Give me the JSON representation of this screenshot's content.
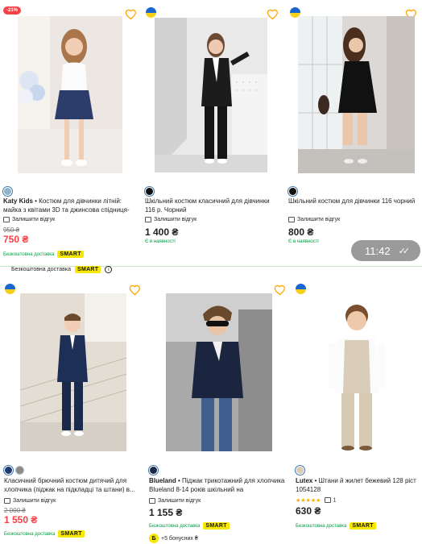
{
  "products_top": [
    {
      "discount": "-21%",
      "colors": [
        "#8fb2cc"
      ],
      "brand": "Katy Kids",
      "title": " • Костюм для дівчинки літній: майка з квітами 3D та джинсова спідниця-шорти з...",
      "review_label": "Залишити відгук",
      "old_price": "950 ₴",
      "price": "750 ₴",
      "shipping": "Безкоштовна доставка",
      "smart": "SMART"
    },
    {
      "colors": [
        "#111111"
      ],
      "brand": "",
      "title": "Шкільний костюм класичний для дівчинки 116 р. Чорний",
      "review_label": "Залишити відгук",
      "price": "1 400 ₴",
      "availability": "Є в наявності"
    },
    {
      "colors": [
        "#111111"
      ],
      "brand": "",
      "title": "Шкільний костюм для дівчинки 116 чорний",
      "review_label": "Залишити відгук",
      "price": "800 ₴",
      "availability": "Є в наявності"
    }
  ],
  "strip": {
    "shipping": "Безкоштовна доставка",
    "smart": "SMART",
    "info": "i",
    "time": "11:42",
    "ticks": "✓✓"
  },
  "products_bottom": [
    {
      "colors": [
        "#1e3a6e",
        "#8a8a8a"
      ],
      "brand": "",
      "title": "Класичний брючний костюм дитячий для хлопчика (піджак на підкладці та штани) в...",
      "review_label": "Залишити відгук",
      "old_price": "2 000 ₴",
      "price": "1 550 ₴",
      "shipping": "Безкоштовна доставка",
      "smart": "SMART"
    },
    {
      "colors": [
        "#1e2a44"
      ],
      "brand": "Blueland",
      "title": " • Піджак трикотажний для хлопчика Blueland 8-14 років шкільний на демісезонни...",
      "review_label": "Залишити відгук",
      "price": "1 155 ₴",
      "shipping": "Безкоштовна доставка",
      "smart": "SMART",
      "bonus_badge": "Б",
      "bonus": "+5 бонусних ₴"
    },
    {
      "colors": [
        "#d8cbb8"
      ],
      "brand": "Lutex",
      "title": " • Штани й жилет бежевий 128 ріст 1054128",
      "rating_stars": 5,
      "stars": "★★★★★",
      "review_count": "1",
      "price": "630 ₴",
      "shipping": "Безкоштовна доставка",
      "smart": "SMART"
    }
  ],
  "colors": {
    "accent_green": "#00a046",
    "sale_red": "#f84147",
    "heart": "#ffa900",
    "smart_yellow": "#f6e800"
  }
}
